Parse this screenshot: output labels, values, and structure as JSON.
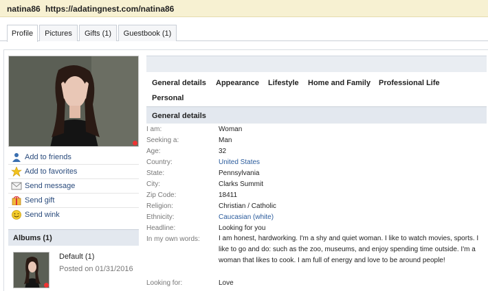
{
  "header": {
    "username": "natina86",
    "url": "https://adatingnest.com/natina86"
  },
  "tabs": [
    {
      "label": "Profile"
    },
    {
      "label": "Pictures"
    },
    {
      "label": "Gifts (1)"
    },
    {
      "label": "Guestbook (1)"
    }
  ],
  "actions": [
    {
      "label": "Add to friends",
      "icon": "person-icon"
    },
    {
      "label": "Add to favorites",
      "icon": "star-icon"
    },
    {
      "label": "Send message",
      "icon": "envelope-icon"
    },
    {
      "label": "Send gift",
      "icon": "gift-icon"
    },
    {
      "label": "Send wink",
      "icon": "smiley-icon"
    }
  ],
  "albums": {
    "title": "Albums (1)",
    "name": "Default (1)",
    "date": "Posted on 01/31/2016"
  },
  "sections": [
    {
      "label": "General details"
    },
    {
      "label": "Appearance"
    },
    {
      "label": "Lifestyle"
    },
    {
      "label": "Home and Family"
    },
    {
      "label": "Professional Life"
    },
    {
      "label": "Personal"
    }
  ],
  "general": {
    "title": "General details",
    "rows": [
      {
        "label": "I am:",
        "value": "Woman"
      },
      {
        "label": "Seeking a:",
        "value": "Man"
      },
      {
        "label": "Age:",
        "value": "32"
      },
      {
        "label": "Country:",
        "value": "United States"
      },
      {
        "label": "State:",
        "value": "Pennsylvania"
      },
      {
        "label": "City:",
        "value": "Clarks Summit"
      },
      {
        "label": "Zip Code:",
        "value": "18411"
      },
      {
        "label": "Religion:",
        "value": "Christian / Catholic"
      },
      {
        "label": "Ethnicity:",
        "value": "Caucasian (white)"
      },
      {
        "label": "Headline:",
        "value": "Looking for you"
      },
      {
        "label": "In my own words:",
        "value": "I am honest, hardworking. I'm a shy and quiet woman. I like to watch movies, sports. I like to go and do: such as the zoo, museums, and enjoy spending time outside. I'm a woman that likes to cook. I am full of energy and love to be around people!"
      },
      {
        "label": "Looking for:",
        "value": "Love"
      }
    ]
  },
  "colors": {
    "topbar": "#f7f1d2",
    "link": "#2a5b9c",
    "section_band": "#e3e8ef"
  }
}
